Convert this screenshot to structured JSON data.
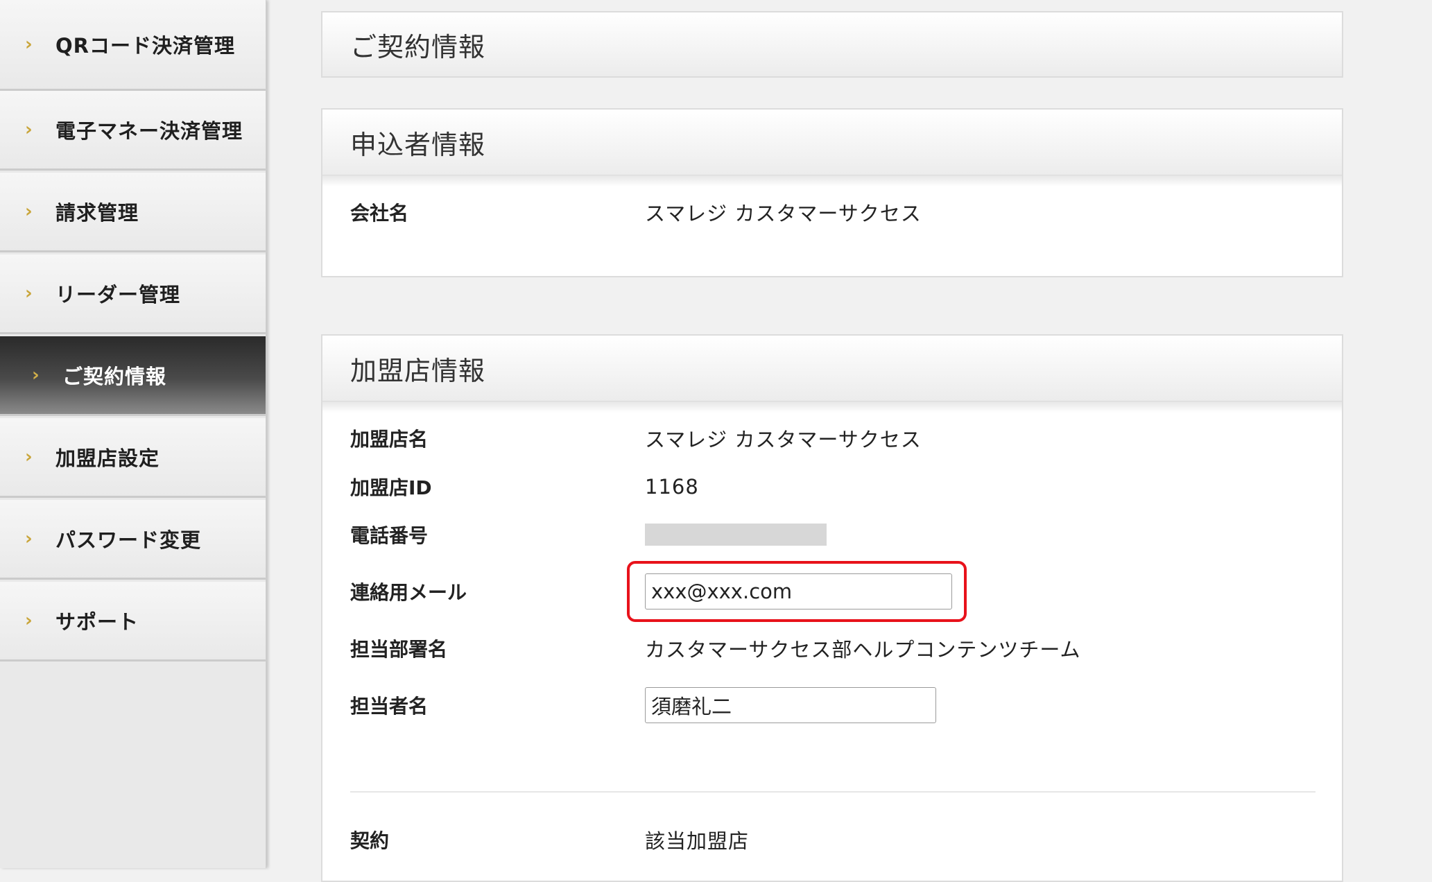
{
  "sidebar": {
    "items": [
      {
        "label": "QRコード決済管理",
        "active": false
      },
      {
        "label": "電子マネー決済管理",
        "active": false
      },
      {
        "label": "請求管理",
        "active": false
      },
      {
        "label": "リーダー管理",
        "active": false
      },
      {
        "label": "ご契約情報",
        "active": true
      },
      {
        "label": "加盟店設定",
        "active": false
      },
      {
        "label": "パスワード変更",
        "active": false
      },
      {
        "label": "サポート",
        "active": false
      }
    ],
    "chevron_icon": "chevron-right-icon",
    "accent_color": "#c9a53a"
  },
  "page": {
    "title": "ご契約情報"
  },
  "applicant": {
    "heading": "申込者情報",
    "company_label": "会社名",
    "company_value": "スマレジ カスタマーサクセス"
  },
  "merchant": {
    "heading": "加盟店情報",
    "name_label": "加盟店名",
    "name_value": "スマレジ カスタマーサクセス",
    "id_label": "加盟店ID",
    "id_value": "1168",
    "phone_label": "電話番号",
    "email_label": "連絡用メール",
    "email_value": "xxx@xxx.com",
    "dept_label": "担当部署名",
    "dept_value": "カスタマーサクセス部ヘルプコンテンツチーム",
    "person_label": "担当者名",
    "person_value": "須磨礼二",
    "contract_label": "契約",
    "contract_value": "該当加盟店"
  },
  "highlight_color": "#e8121b"
}
